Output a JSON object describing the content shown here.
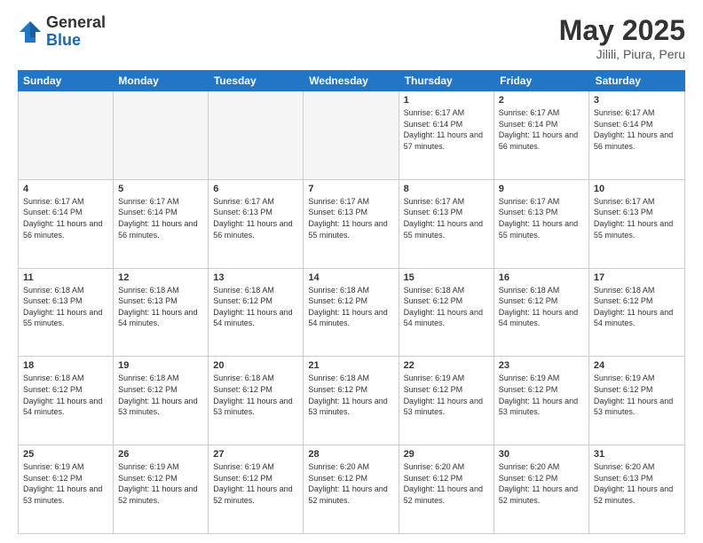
{
  "header": {
    "logo_general": "General",
    "logo_blue": "Blue",
    "title": "May 2025",
    "location": "Jilili, Piura, Peru"
  },
  "days_of_week": [
    "Sunday",
    "Monday",
    "Tuesday",
    "Wednesday",
    "Thursday",
    "Friday",
    "Saturday"
  ],
  "weeks": [
    [
      {
        "day": "",
        "text": "",
        "empty": true
      },
      {
        "day": "",
        "text": "",
        "empty": true
      },
      {
        "day": "",
        "text": "",
        "empty": true
      },
      {
        "day": "",
        "text": "",
        "empty": true
      },
      {
        "day": "1",
        "text": "Sunrise: 6:17 AM\nSunset: 6:14 PM\nDaylight: 11 hours and 57 minutes."
      },
      {
        "day": "2",
        "text": "Sunrise: 6:17 AM\nSunset: 6:14 PM\nDaylight: 11 hours and 56 minutes."
      },
      {
        "day": "3",
        "text": "Sunrise: 6:17 AM\nSunset: 6:14 PM\nDaylight: 11 hours and 56 minutes."
      }
    ],
    [
      {
        "day": "4",
        "text": "Sunrise: 6:17 AM\nSunset: 6:14 PM\nDaylight: 11 hours and 56 minutes."
      },
      {
        "day": "5",
        "text": "Sunrise: 6:17 AM\nSunset: 6:14 PM\nDaylight: 11 hours and 56 minutes."
      },
      {
        "day": "6",
        "text": "Sunrise: 6:17 AM\nSunset: 6:13 PM\nDaylight: 11 hours and 56 minutes."
      },
      {
        "day": "7",
        "text": "Sunrise: 6:17 AM\nSunset: 6:13 PM\nDaylight: 11 hours and 55 minutes."
      },
      {
        "day": "8",
        "text": "Sunrise: 6:17 AM\nSunset: 6:13 PM\nDaylight: 11 hours and 55 minutes."
      },
      {
        "day": "9",
        "text": "Sunrise: 6:17 AM\nSunset: 6:13 PM\nDaylight: 11 hours and 55 minutes."
      },
      {
        "day": "10",
        "text": "Sunrise: 6:17 AM\nSunset: 6:13 PM\nDaylight: 11 hours and 55 minutes."
      }
    ],
    [
      {
        "day": "11",
        "text": "Sunrise: 6:18 AM\nSunset: 6:13 PM\nDaylight: 11 hours and 55 minutes."
      },
      {
        "day": "12",
        "text": "Sunrise: 6:18 AM\nSunset: 6:13 PM\nDaylight: 11 hours and 54 minutes."
      },
      {
        "day": "13",
        "text": "Sunrise: 6:18 AM\nSunset: 6:12 PM\nDaylight: 11 hours and 54 minutes."
      },
      {
        "day": "14",
        "text": "Sunrise: 6:18 AM\nSunset: 6:12 PM\nDaylight: 11 hours and 54 minutes."
      },
      {
        "day": "15",
        "text": "Sunrise: 6:18 AM\nSunset: 6:12 PM\nDaylight: 11 hours and 54 minutes."
      },
      {
        "day": "16",
        "text": "Sunrise: 6:18 AM\nSunset: 6:12 PM\nDaylight: 11 hours and 54 minutes."
      },
      {
        "day": "17",
        "text": "Sunrise: 6:18 AM\nSunset: 6:12 PM\nDaylight: 11 hours and 54 minutes."
      }
    ],
    [
      {
        "day": "18",
        "text": "Sunrise: 6:18 AM\nSunset: 6:12 PM\nDaylight: 11 hours and 54 minutes."
      },
      {
        "day": "19",
        "text": "Sunrise: 6:18 AM\nSunset: 6:12 PM\nDaylight: 11 hours and 53 minutes."
      },
      {
        "day": "20",
        "text": "Sunrise: 6:18 AM\nSunset: 6:12 PM\nDaylight: 11 hours and 53 minutes."
      },
      {
        "day": "21",
        "text": "Sunrise: 6:18 AM\nSunset: 6:12 PM\nDaylight: 11 hours and 53 minutes."
      },
      {
        "day": "22",
        "text": "Sunrise: 6:19 AM\nSunset: 6:12 PM\nDaylight: 11 hours and 53 minutes."
      },
      {
        "day": "23",
        "text": "Sunrise: 6:19 AM\nSunset: 6:12 PM\nDaylight: 11 hours and 53 minutes."
      },
      {
        "day": "24",
        "text": "Sunrise: 6:19 AM\nSunset: 6:12 PM\nDaylight: 11 hours and 53 minutes."
      }
    ],
    [
      {
        "day": "25",
        "text": "Sunrise: 6:19 AM\nSunset: 6:12 PM\nDaylight: 11 hours and 53 minutes."
      },
      {
        "day": "26",
        "text": "Sunrise: 6:19 AM\nSunset: 6:12 PM\nDaylight: 11 hours and 52 minutes."
      },
      {
        "day": "27",
        "text": "Sunrise: 6:19 AM\nSunset: 6:12 PM\nDaylight: 11 hours and 52 minutes."
      },
      {
        "day": "28",
        "text": "Sunrise: 6:20 AM\nSunset: 6:12 PM\nDaylight: 11 hours and 52 minutes."
      },
      {
        "day": "29",
        "text": "Sunrise: 6:20 AM\nSunset: 6:12 PM\nDaylight: 11 hours and 52 minutes."
      },
      {
        "day": "30",
        "text": "Sunrise: 6:20 AM\nSunset: 6:12 PM\nDaylight: 11 hours and 52 minutes."
      },
      {
        "day": "31",
        "text": "Sunrise: 6:20 AM\nSunset: 6:13 PM\nDaylight: 11 hours and 52 minutes."
      }
    ]
  ]
}
